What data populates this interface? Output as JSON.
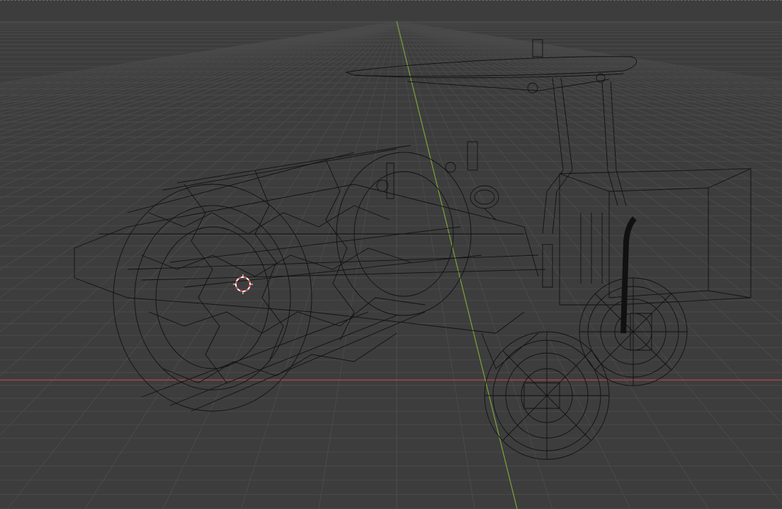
{
  "app": {
    "name": "3D viewport",
    "shading_mode": "wireframe",
    "view": "perspective"
  },
  "colors": {
    "background": "#3d3d3d",
    "grid_line": "#4a4a4a",
    "x_axis": "#b5484f",
    "y_axis": "#7aa53a",
    "wire": "#111111",
    "cursor_red": "#e04a4a",
    "cursor_white": "#ffffff"
  },
  "icons": {
    "cursor": "3d-cursor-icon"
  },
  "scene": {
    "object": "road-roller-wireframe-model"
  }
}
